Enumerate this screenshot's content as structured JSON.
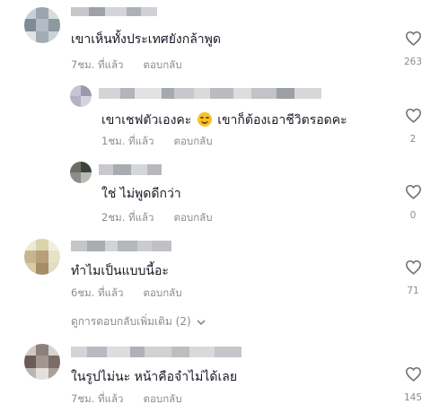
{
  "comments": [
    {
      "username": "ap...2010",
      "text": "เขาเห็นทั้งประเทศยังกล้าพูด",
      "time": "7ชม. ที่แล้ว",
      "reply_label": "ตอบกลับ",
      "likes": "263"
    },
    {
      "text_before_emoji": "เขาเชฟตัวเองคะ",
      "emoji": "smiling-face-icon",
      "text_after_emoji": "เขาก็ต้องเอาชีวิตรอดคะ",
      "time": "1ชม. ที่แล้ว",
      "reply_label": "ตอบกลับ",
      "likes": "2"
    },
    {
      "text": "ใช่ ไม่พูดดีกว่า",
      "time": "2ชม. ที่แล้ว",
      "reply_label": "ตอบกลับ",
      "likes": "0"
    },
    {
      "text": "ทำไมเป็นแบบนี้อะ",
      "time": "6ชม. ที่แล้ว",
      "reply_label": "ตอบกลับ",
      "likes": "71"
    },
    {
      "text": "ในรูปไม่นะ หน้าคือจำไม่ได้เลย",
      "time": "7ชม. ที่แล้ว",
      "reply_label": "ตอบกลับ",
      "likes": "145"
    }
  ],
  "view_more_replies": "ดูการตอบกลับเพิ่มเติม (2)",
  "icons": {
    "like": "heart-outline-icon",
    "expand": "chevron-down-icon"
  },
  "colors": {
    "text": "#161823",
    "muted": "#8a8b91",
    "icon": "#6f7077"
  }
}
